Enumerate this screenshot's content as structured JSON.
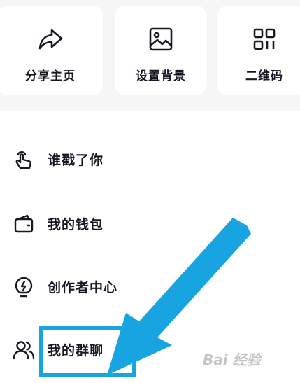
{
  "quick_actions": [
    {
      "label": "分享主页",
      "icon": "share-arrow-icon"
    },
    {
      "label": "设置背景",
      "icon": "image-icon"
    },
    {
      "label": "二维码",
      "icon": "qr-code-icon"
    }
  ],
  "menu": [
    {
      "label": "谁戳了你",
      "icon": "tap-hand-icon"
    },
    {
      "label": "我的钱包",
      "icon": "wallet-icon"
    },
    {
      "label": "创作者中心",
      "icon": "lightbulb-bolt-icon"
    },
    {
      "label": "我的群聊",
      "icon": "group-users-icon"
    }
  ],
  "annotation": {
    "highlight_color": "#18a4e0"
  },
  "watermark": {
    "text": "Bai 经验"
  }
}
